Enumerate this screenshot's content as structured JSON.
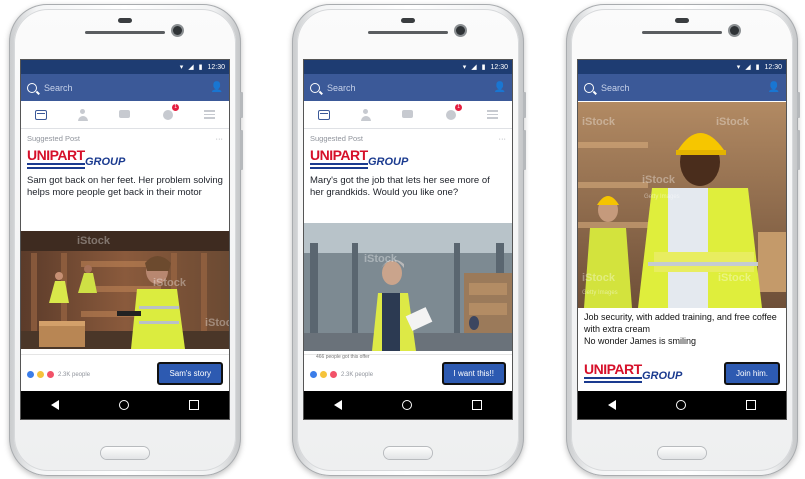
{
  "status": {
    "time": "12:30",
    "wifi_icon": "wifi-icon",
    "signal_icon": "signal-icon",
    "battery_icon": "battery-icon"
  },
  "search": {
    "placeholder": "Search"
  },
  "colors": {
    "facebook_blue": "#3b5998",
    "status_blue": "#1e3c72",
    "unipart_red": "#d6102a",
    "unipart_blue": "#1a3a8f",
    "cta_blue": "#2d5ab1"
  },
  "brand": {
    "unipart": "UNIPART",
    "group": "GROUP"
  },
  "phones": [
    {
      "suggested": "Suggested Post",
      "more": "···",
      "text": "Sam got back on her feet. Her problem solving helps more people get back in their motor",
      "reactions": "2.3K people",
      "cta": "Sam's story"
    },
    {
      "suggested": "Suggested Post",
      "more": "···",
      "text": "Mary's got the job that lets her see more of her grandkids. Would you like one?",
      "caption": "466 people got this offer",
      "reactions": "2.3K people",
      "cta": "I want this!!"
    },
    {
      "text": "Job security, with added training, and free coffee with extra cream",
      "text2": "No wonder James is smiling",
      "cta": "Join him."
    }
  ],
  "watermarks": {
    "istock": "iStock",
    "getty": "Getty Images"
  }
}
